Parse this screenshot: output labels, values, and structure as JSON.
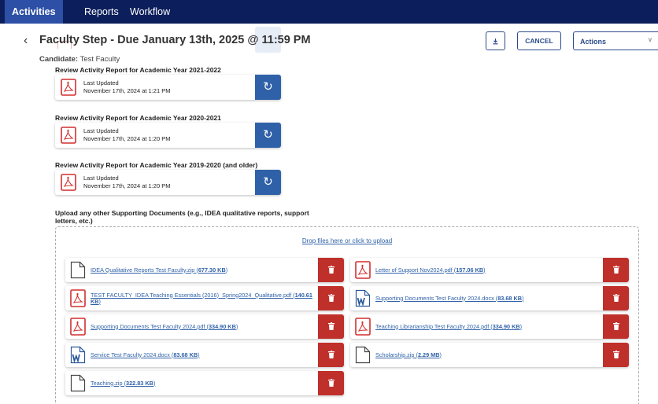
{
  "nav": {
    "tabs": [
      {
        "label": "Activities"
      },
      {
        "label": "Reports"
      },
      {
        "label": "Workflow"
      }
    ]
  },
  "header": {
    "back_icon": "chevron-left-icon",
    "title": "Faculty Step - Due January 13th, 2025 @ 11:59 PM",
    "candidate_label": "Candidate:",
    "candidate_name": "Test Faculty",
    "download_icon": "download-icon",
    "cancel_label": "CANCEL",
    "actions_label": "Actions",
    "actions_icon": "chevron-down-icon"
  },
  "reports": [
    {
      "heading": "Review Activity Report for Academic Year 2021-2022",
      "updated_label": "Last Updated",
      "updated_date": "November 17th, 2024 at 1:21 PM"
    },
    {
      "heading": "Review Activity Report for Academic Year 2020-2021",
      "updated_label": "Last Updated",
      "updated_date": "November 17th, 2024 at 1:20 PM"
    },
    {
      "heading": "Review Activity Report for Academic Year 2019-2020 (and older)",
      "updated_label": "Last Updated",
      "updated_date": "November 17th, 2024 at 1:20 PM"
    }
  ],
  "upload": {
    "label": "Upload any other Supporting Documents (e.g., IDEA qualitative reports, support letters, etc.)",
    "drop_text": "Drop files here or click to upload"
  },
  "files": [
    {
      "name": "IDEA Qualitative Reports Test Faculty.zip",
      "size": "677.30 KB",
      "icon": "file-icon"
    },
    {
      "name": "Letter of Support Nov2024.pdf",
      "size": "157.06 KB",
      "icon": "pdf-icon"
    },
    {
      "name": "TEST FACULTY_IDEA Teaching Essentials (2016)_Spring2024_Qualitative.pdf",
      "size": "140.61 KB",
      "icon": "pdf-icon"
    },
    {
      "name": "Supporting Documents Test Faculty 2024.docx",
      "size": "83.68 KB",
      "icon": "word-icon"
    },
    {
      "name": "Supporting Documents Test Faculty 2024.pdf",
      "size": "334.90 KB",
      "icon": "pdf-icon"
    },
    {
      "name": "Teaching Librarianship Test Faculty 2024.pdf",
      "size": "334.90 KB",
      "icon": "pdf-icon"
    },
    {
      "name": "Service Test Faculty 2024.docx",
      "size": "83.68 KB",
      "icon": "word-icon"
    },
    {
      "name": "Scholarship.zip",
      "size": "2.29 MB",
      "icon": "file-icon"
    },
    {
      "name": "Teaching.zip",
      "size": "322.83 KB",
      "icon": "file-icon"
    }
  ],
  "colors": {
    "nav_bg": "#0c1f5c",
    "nav_active": "#2d4fa5",
    "primary": "#2f61a8",
    "delete": "#c0302b",
    "pdf": "#d32f2f"
  }
}
